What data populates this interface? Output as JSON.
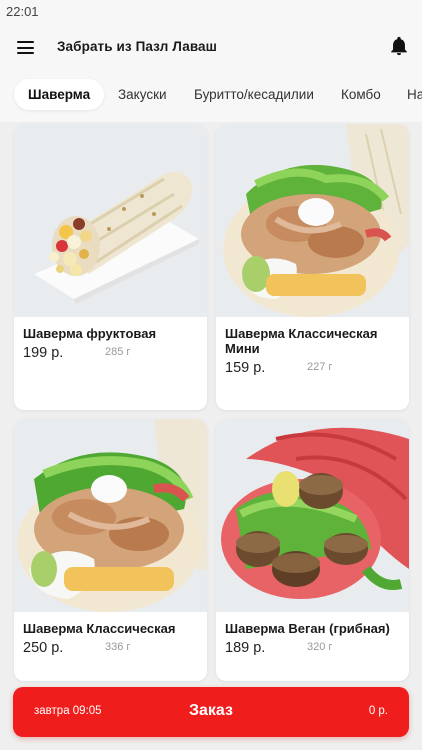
{
  "status": {
    "time": "22:01"
  },
  "header": {
    "title": "Забрать из Пазл Лаваш",
    "menu_icon": "hamburger-menu-icon",
    "bell_icon": "bell-icon"
  },
  "tabs": [
    {
      "label": "Шаверма",
      "active": true
    },
    {
      "label": "Закуски",
      "active": false
    },
    {
      "label": "Буритто/кесадилии",
      "active": false
    },
    {
      "label": "Комбо",
      "active": false
    },
    {
      "label": "Напитки",
      "active": false
    }
  ],
  "products": [
    {
      "name": "Шаверма фруктовая",
      "price": "199 р.",
      "weight": "285 г"
    },
    {
      "name": "Шаверма Классическая Мини",
      "price": "159 р.",
      "weight": "227 г"
    },
    {
      "name": "Шаверма Классическая",
      "price": "250 р.",
      "weight": "336 г"
    },
    {
      "name": "Шаверма Веган (грибная)",
      "price": "189 р.",
      "weight": "320 г"
    }
  ],
  "order_bar": {
    "time": "завтра 09:05",
    "label": "Заказ",
    "sum": "0 р."
  },
  "colors": {
    "accent": "#f01d1d",
    "background": "#efefef"
  }
}
